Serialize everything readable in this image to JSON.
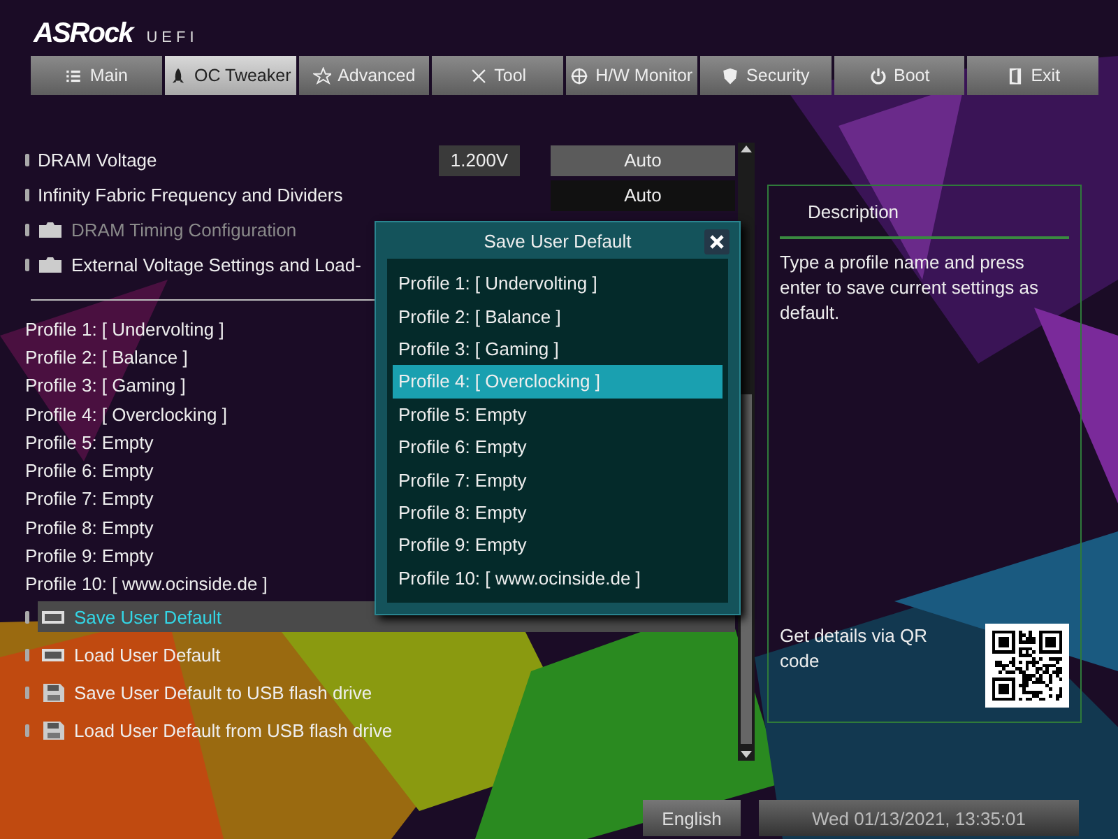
{
  "header": {
    "logo": "ASRock",
    "subtitle": "UEFI"
  },
  "tabs": [
    {
      "label": "Main",
      "selected": false
    },
    {
      "label": "OC Tweaker",
      "selected": true
    },
    {
      "label": "Advanced",
      "selected": false
    },
    {
      "label": "Tool",
      "selected": false
    },
    {
      "label": "H/W Monitor",
      "selected": false
    },
    {
      "label": "Security",
      "selected": false
    },
    {
      "label": "Boot",
      "selected": false
    },
    {
      "label": "Exit",
      "selected": false
    }
  ],
  "items": [
    {
      "kind": "setting",
      "label": "DRAM Voltage",
      "value": "1.200V",
      "option": "Auto",
      "highlighted": true
    },
    {
      "kind": "setting",
      "label": "Infinity Fabric Frequency and Dividers",
      "option": "Auto",
      "highlighted": false
    },
    {
      "kind": "folder",
      "label": "DRAM Timing Configuration",
      "disabled": true
    },
    {
      "kind": "folder",
      "label": "External Voltage Settings and Load-",
      "disabled": false
    },
    {
      "kind": "separator"
    },
    {
      "kind": "text",
      "label": "Profile 1: [ Undervolting ]"
    },
    {
      "kind": "text",
      "label": "Profile 2: [ Balance ]"
    },
    {
      "kind": "text",
      "label": "Profile 3: [ Gaming ]"
    },
    {
      "kind": "text",
      "label": "Profile 4: [ Overclocking ]"
    },
    {
      "kind": "text",
      "label": "Profile 5: Empty"
    },
    {
      "kind": "text",
      "label": "Profile 6: Empty"
    },
    {
      "kind": "text",
      "label": "Profile 7: Empty"
    },
    {
      "kind": "text",
      "label": "Profile 8: Empty"
    },
    {
      "kind": "text",
      "label": "Profile 9: Empty"
    },
    {
      "kind": "text",
      "label": "Profile 10: [ www.ocinside.de ]"
    },
    {
      "kind": "bios",
      "label": "Save User Default",
      "selected": true
    },
    {
      "kind": "bios",
      "label": "Load User Default",
      "selected": false
    },
    {
      "kind": "usb",
      "label": "Save User Default to USB flash drive",
      "selected": false
    },
    {
      "kind": "usb",
      "label": "Load User Default from USB flash drive",
      "selected": false
    }
  ],
  "description": {
    "title": "Description",
    "text": "Type a profile name and press enter to save current settings as default.",
    "qr_text": "Get details via QR code"
  },
  "dialog": {
    "title": "Save User Default",
    "profiles": [
      {
        "label": "Profile 1: [ Undervolting ]",
        "selected": false
      },
      {
        "label": "Profile 2: [ Balance ]",
        "selected": false
      },
      {
        "label": "Profile 3: [ Gaming ]",
        "selected": false
      },
      {
        "label": "Profile 4: [ Overclocking ]",
        "selected": true
      },
      {
        "label": "Profile 5: Empty",
        "selected": false
      },
      {
        "label": "Profile 6: Empty",
        "selected": false
      },
      {
        "label": "Profile 7: Empty",
        "selected": false
      },
      {
        "label": "Profile 8: Empty",
        "selected": false
      },
      {
        "label": "Profile 9: Empty",
        "selected": false
      },
      {
        "label": "Profile 10: [ www.ocinside.de ]",
        "selected": false
      }
    ]
  },
  "footer": {
    "language": "English",
    "datetime": "Wed 01/13/2021, 13:35:01"
  }
}
